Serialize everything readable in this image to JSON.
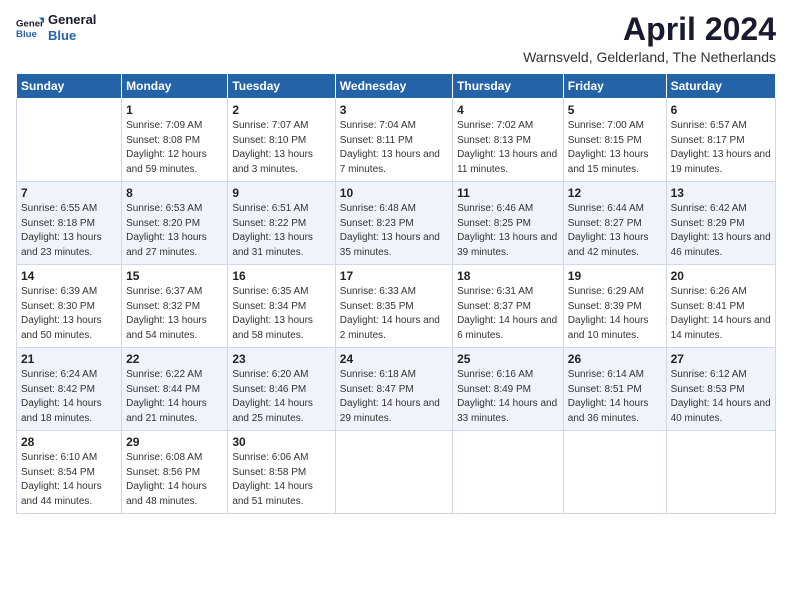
{
  "logo": {
    "line1": "General",
    "line2": "Blue"
  },
  "title": "April 2024",
  "subtitle": "Warnsveld, Gelderland, The Netherlands",
  "days_of_week": [
    "Sunday",
    "Monday",
    "Tuesday",
    "Wednesday",
    "Thursday",
    "Friday",
    "Saturday"
  ],
  "weeks": [
    [
      {
        "num": "",
        "sunrise": "",
        "sunset": "",
        "daylight": ""
      },
      {
        "num": "1",
        "sunrise": "Sunrise: 7:09 AM",
        "sunset": "Sunset: 8:08 PM",
        "daylight": "Daylight: 12 hours and 59 minutes."
      },
      {
        "num": "2",
        "sunrise": "Sunrise: 7:07 AM",
        "sunset": "Sunset: 8:10 PM",
        "daylight": "Daylight: 13 hours and 3 minutes."
      },
      {
        "num": "3",
        "sunrise": "Sunrise: 7:04 AM",
        "sunset": "Sunset: 8:11 PM",
        "daylight": "Daylight: 13 hours and 7 minutes."
      },
      {
        "num": "4",
        "sunrise": "Sunrise: 7:02 AM",
        "sunset": "Sunset: 8:13 PM",
        "daylight": "Daylight: 13 hours and 11 minutes."
      },
      {
        "num": "5",
        "sunrise": "Sunrise: 7:00 AM",
        "sunset": "Sunset: 8:15 PM",
        "daylight": "Daylight: 13 hours and 15 minutes."
      },
      {
        "num": "6",
        "sunrise": "Sunrise: 6:57 AM",
        "sunset": "Sunset: 8:17 PM",
        "daylight": "Daylight: 13 hours and 19 minutes."
      }
    ],
    [
      {
        "num": "7",
        "sunrise": "Sunrise: 6:55 AM",
        "sunset": "Sunset: 8:18 PM",
        "daylight": "Daylight: 13 hours and 23 minutes."
      },
      {
        "num": "8",
        "sunrise": "Sunrise: 6:53 AM",
        "sunset": "Sunset: 8:20 PM",
        "daylight": "Daylight: 13 hours and 27 minutes."
      },
      {
        "num": "9",
        "sunrise": "Sunrise: 6:51 AM",
        "sunset": "Sunset: 8:22 PM",
        "daylight": "Daylight: 13 hours and 31 minutes."
      },
      {
        "num": "10",
        "sunrise": "Sunrise: 6:48 AM",
        "sunset": "Sunset: 8:23 PM",
        "daylight": "Daylight: 13 hours and 35 minutes."
      },
      {
        "num": "11",
        "sunrise": "Sunrise: 6:46 AM",
        "sunset": "Sunset: 8:25 PM",
        "daylight": "Daylight: 13 hours and 39 minutes."
      },
      {
        "num": "12",
        "sunrise": "Sunrise: 6:44 AM",
        "sunset": "Sunset: 8:27 PM",
        "daylight": "Daylight: 13 hours and 42 minutes."
      },
      {
        "num": "13",
        "sunrise": "Sunrise: 6:42 AM",
        "sunset": "Sunset: 8:29 PM",
        "daylight": "Daylight: 13 hours and 46 minutes."
      }
    ],
    [
      {
        "num": "14",
        "sunrise": "Sunrise: 6:39 AM",
        "sunset": "Sunset: 8:30 PM",
        "daylight": "Daylight: 13 hours and 50 minutes."
      },
      {
        "num": "15",
        "sunrise": "Sunrise: 6:37 AM",
        "sunset": "Sunset: 8:32 PM",
        "daylight": "Daylight: 13 hours and 54 minutes."
      },
      {
        "num": "16",
        "sunrise": "Sunrise: 6:35 AM",
        "sunset": "Sunset: 8:34 PM",
        "daylight": "Daylight: 13 hours and 58 minutes."
      },
      {
        "num": "17",
        "sunrise": "Sunrise: 6:33 AM",
        "sunset": "Sunset: 8:35 PM",
        "daylight": "Daylight: 14 hours and 2 minutes."
      },
      {
        "num": "18",
        "sunrise": "Sunrise: 6:31 AM",
        "sunset": "Sunset: 8:37 PM",
        "daylight": "Daylight: 14 hours and 6 minutes."
      },
      {
        "num": "19",
        "sunrise": "Sunrise: 6:29 AM",
        "sunset": "Sunset: 8:39 PM",
        "daylight": "Daylight: 14 hours and 10 minutes."
      },
      {
        "num": "20",
        "sunrise": "Sunrise: 6:26 AM",
        "sunset": "Sunset: 8:41 PM",
        "daylight": "Daylight: 14 hours and 14 minutes."
      }
    ],
    [
      {
        "num": "21",
        "sunrise": "Sunrise: 6:24 AM",
        "sunset": "Sunset: 8:42 PM",
        "daylight": "Daylight: 14 hours and 18 minutes."
      },
      {
        "num": "22",
        "sunrise": "Sunrise: 6:22 AM",
        "sunset": "Sunset: 8:44 PM",
        "daylight": "Daylight: 14 hours and 21 minutes."
      },
      {
        "num": "23",
        "sunrise": "Sunrise: 6:20 AM",
        "sunset": "Sunset: 8:46 PM",
        "daylight": "Daylight: 14 hours and 25 minutes."
      },
      {
        "num": "24",
        "sunrise": "Sunrise: 6:18 AM",
        "sunset": "Sunset: 8:47 PM",
        "daylight": "Daylight: 14 hours and 29 minutes."
      },
      {
        "num": "25",
        "sunrise": "Sunrise: 6:16 AM",
        "sunset": "Sunset: 8:49 PM",
        "daylight": "Daylight: 14 hours and 33 minutes."
      },
      {
        "num": "26",
        "sunrise": "Sunrise: 6:14 AM",
        "sunset": "Sunset: 8:51 PM",
        "daylight": "Daylight: 14 hours and 36 minutes."
      },
      {
        "num": "27",
        "sunrise": "Sunrise: 6:12 AM",
        "sunset": "Sunset: 8:53 PM",
        "daylight": "Daylight: 14 hours and 40 minutes."
      }
    ],
    [
      {
        "num": "28",
        "sunrise": "Sunrise: 6:10 AM",
        "sunset": "Sunset: 8:54 PM",
        "daylight": "Daylight: 14 hours and 44 minutes."
      },
      {
        "num": "29",
        "sunrise": "Sunrise: 6:08 AM",
        "sunset": "Sunset: 8:56 PM",
        "daylight": "Daylight: 14 hours and 48 minutes."
      },
      {
        "num": "30",
        "sunrise": "Sunrise: 6:06 AM",
        "sunset": "Sunset: 8:58 PM",
        "daylight": "Daylight: 14 hours and 51 minutes."
      },
      {
        "num": "",
        "sunrise": "",
        "sunset": "",
        "daylight": ""
      },
      {
        "num": "",
        "sunrise": "",
        "sunset": "",
        "daylight": ""
      },
      {
        "num": "",
        "sunrise": "",
        "sunset": "",
        "daylight": ""
      },
      {
        "num": "",
        "sunrise": "",
        "sunset": "",
        "daylight": ""
      }
    ]
  ]
}
